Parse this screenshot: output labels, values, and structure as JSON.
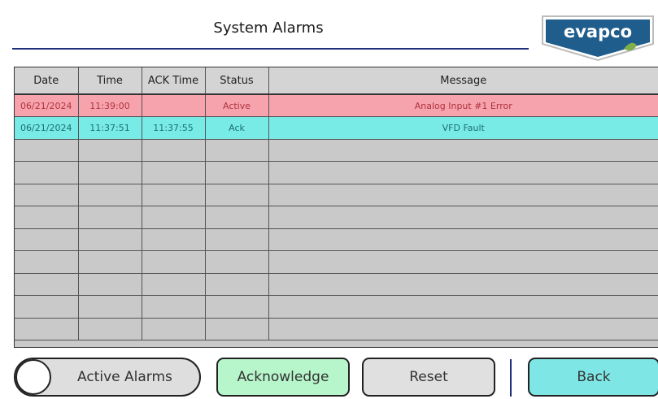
{
  "header": {
    "title": "System Alarms",
    "logo_text": "evapco"
  },
  "table": {
    "columns": [
      "Date",
      "Time",
      "ACK Time",
      "Status",
      "Message"
    ],
    "rows": [
      {
        "date": "06/21/2024",
        "time": "11:39:00",
        "ack_time": "",
        "status": "Active",
        "message": "Analog Input #1 Error"
      },
      {
        "date": "06/21/2024",
        "time": "11:37:51",
        "ack_time": "11:37:55",
        "status": "Ack",
        "message": "VFD Fault"
      }
    ],
    "empty_rows": 9
  },
  "buttons": {
    "active_alarms": "Active Alarms",
    "acknowledge": "Acknowledge",
    "reset": "Reset",
    "back": "Back"
  },
  "colors": {
    "active_row": "#f6a3ad",
    "ack_row": "#79ebe6",
    "acknowledge_button": "#b7f5cb",
    "back_button": "#7fe6e6",
    "title_rule": "#1f2f7a"
  }
}
